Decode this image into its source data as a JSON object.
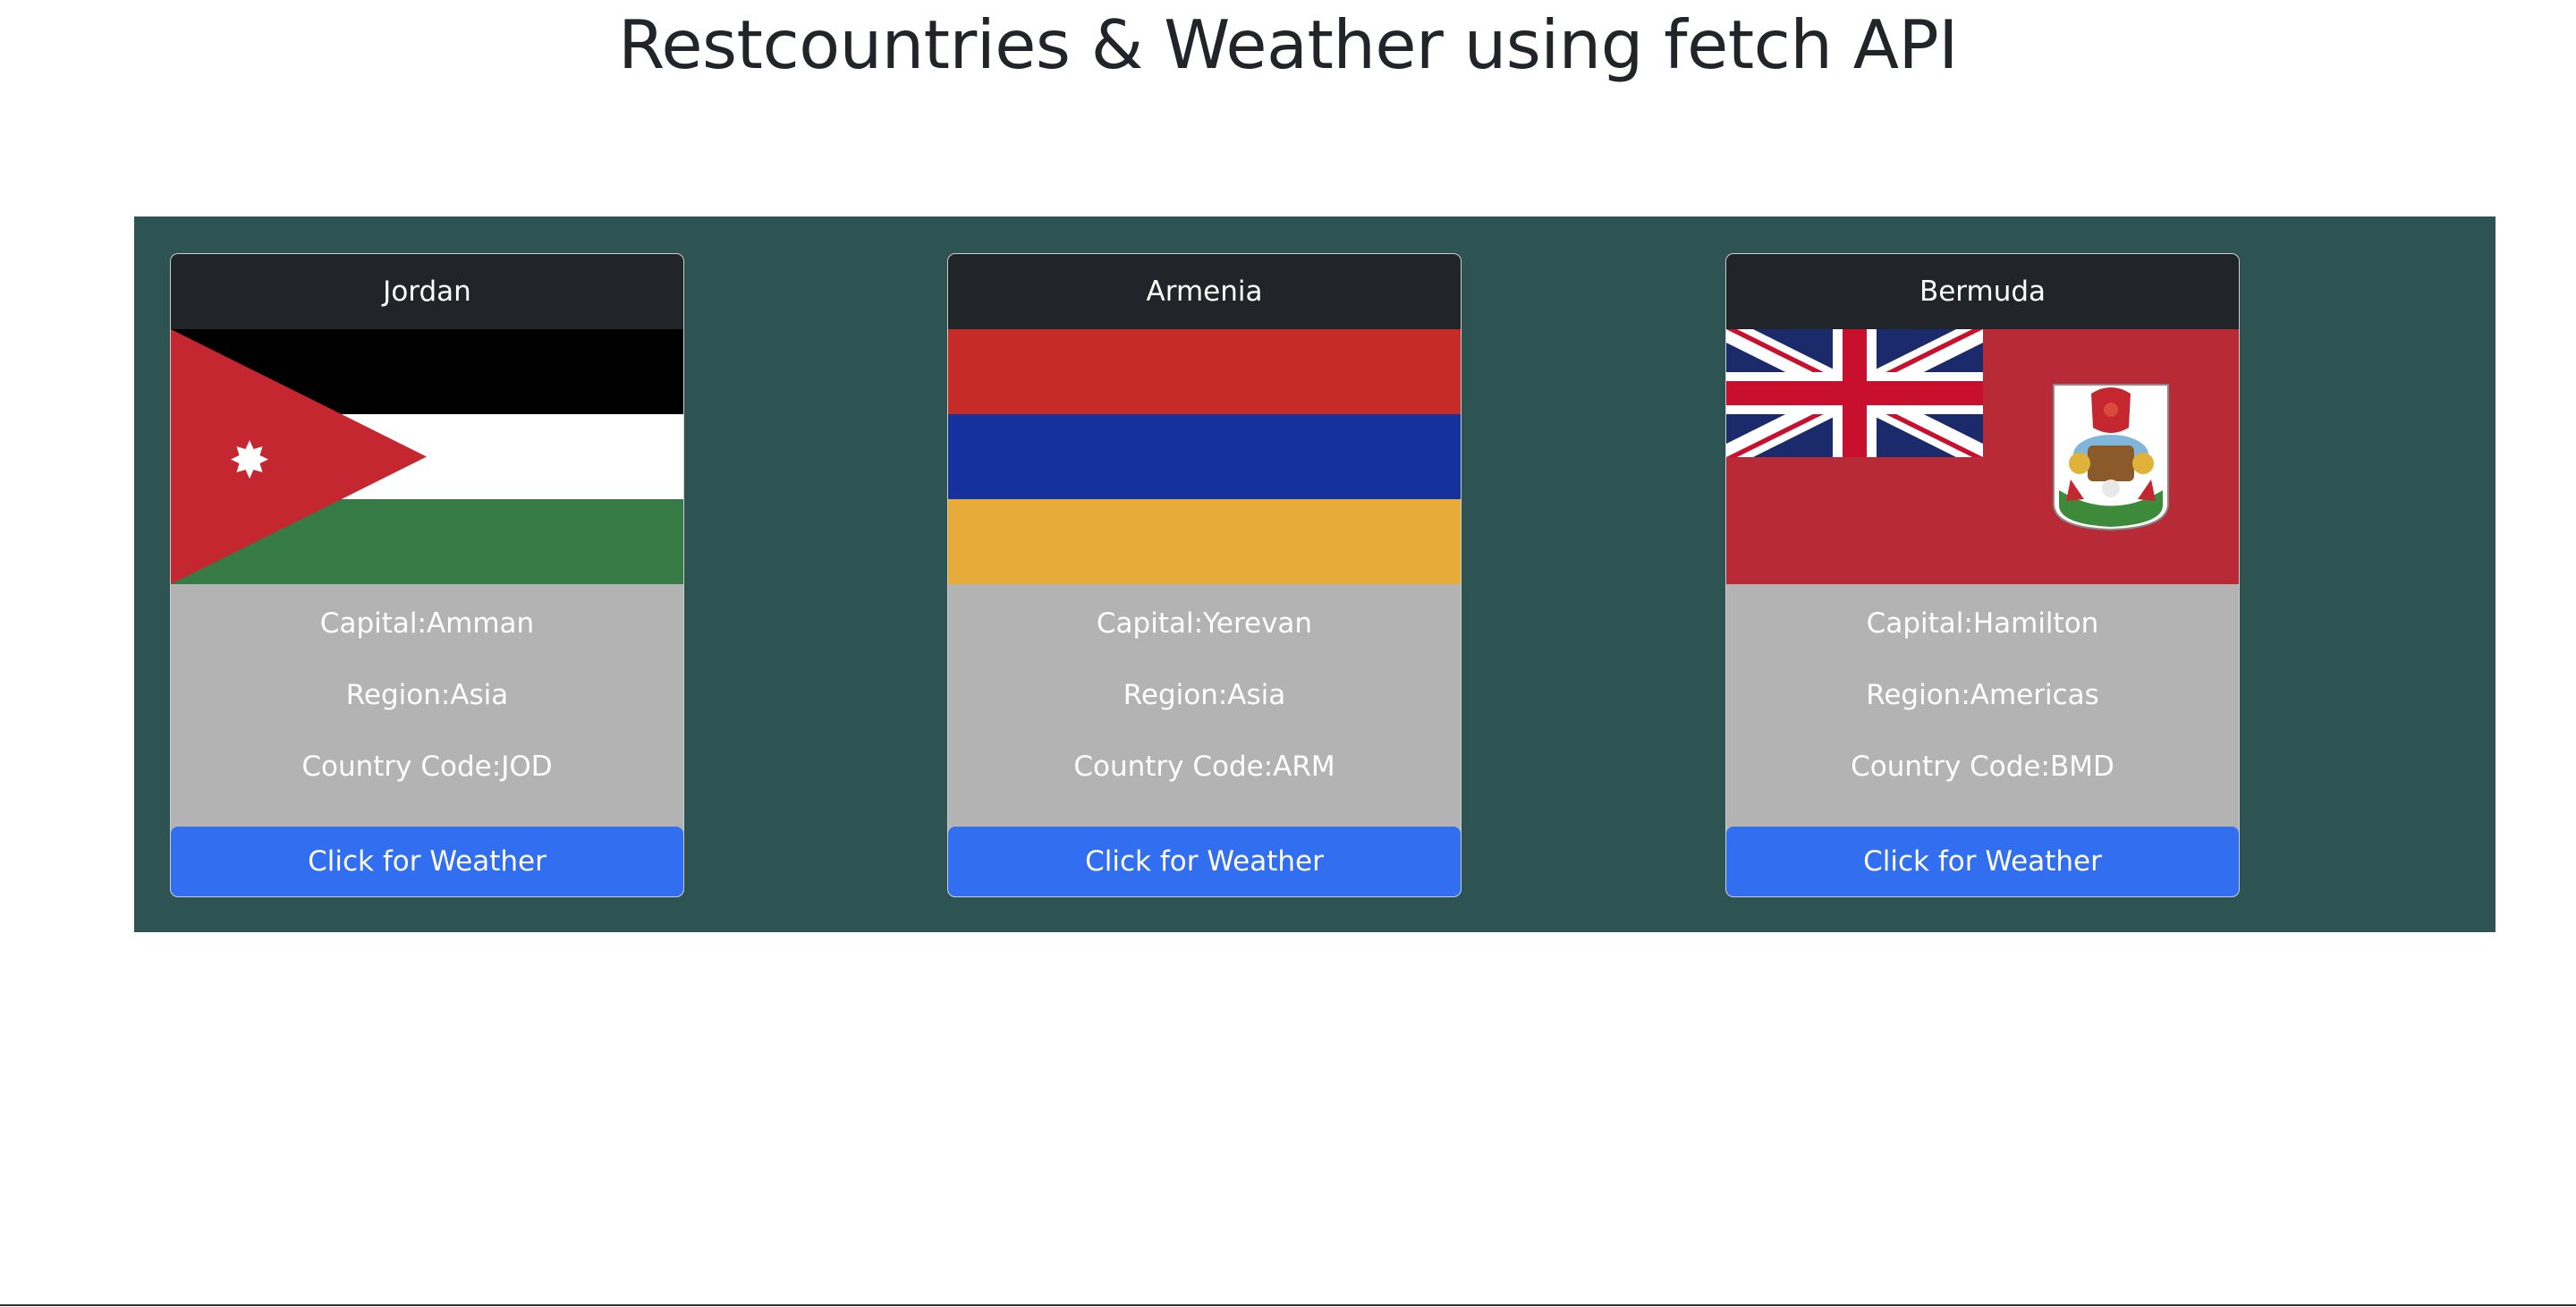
{
  "page": {
    "title": "Restcountries & Weather using fetch API"
  },
  "colors": {
    "container_bg": "#2d5353",
    "card_header_bg": "#212529",
    "card_body_bg": "#b3b3b3",
    "button_bg": "#326ff0"
  },
  "countries": [
    {
      "name": "Jordan",
      "flag_icon": "jordan-flag",
      "capital": "Capital:Amman",
      "region": "Region:Asia",
      "code": "Country Code:JOD",
      "button": "Click for Weather"
    },
    {
      "name": "Armenia",
      "flag_icon": "armenia-flag",
      "capital": "Capital:Yerevan",
      "region": "Region:Asia",
      "code": "Country Code:ARM",
      "button": "Click for Weather"
    },
    {
      "name": "Bermuda",
      "flag_icon": "bermuda-flag",
      "capital": "Capital:Hamilton",
      "region": "Region:Americas",
      "code": "Country Code:BMD",
      "button": "Click for Weather"
    }
  ]
}
